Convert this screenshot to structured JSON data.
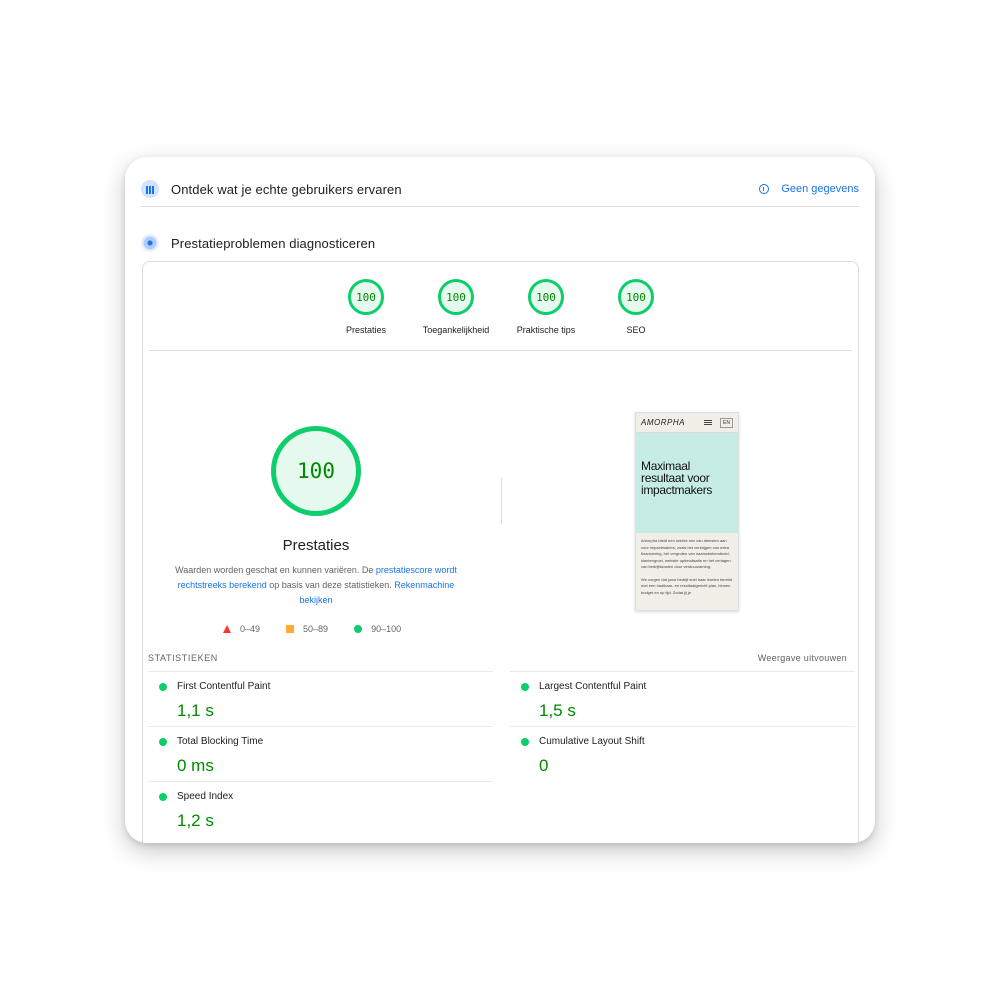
{
  "header": {
    "field_data_title": "Ontdek wat je echte gebruikers ervaren",
    "no_data_link": "Geen gegevens",
    "diagnose_title": "Prestatieproblemen diagnosticeren"
  },
  "categories": [
    {
      "score": "100",
      "label": "Prestaties"
    },
    {
      "score": "100",
      "label": "Toegankelijkheid"
    },
    {
      "score": "100",
      "label": "Praktische tips"
    },
    {
      "score": "100",
      "label": "SEO"
    }
  ],
  "performance": {
    "score": "100",
    "title": "Prestaties",
    "desc_part1": "Waarden worden geschat en kunnen variëren. De ",
    "desc_link1": "prestatiescore wordt rechtstreeks berekend",
    "desc_part2": " op basis van deze statistieken. ",
    "desc_link2": "Rekenmachine bekijken"
  },
  "legend": {
    "fail": "0–49",
    "average": "50–89",
    "pass": "90–100"
  },
  "screenshot": {
    "logo": "AMORPHA",
    "lang": "EN",
    "hero": "Maximaal resultaat voor impactmakers",
    "para1": "Amorpha biedt een unieke mix van diensten aan voor impactmakers, zoals het verkrijgen van extra financiering, het vergroten van naamsbekendheid, klantengroei, website optimalisatie en het verlagen van bedrijfskosten door verduurzaming.",
    "para2": "We zorgen dat jouw bedrijf snel haar doelen bereikt met een haalbaar- en resultaatgericht plan, binnen budget en op tijd. Zodat jij je"
  },
  "stats": {
    "title": "STATISTIEKEN",
    "expand": "Weergave uitvouwen",
    "metrics": [
      {
        "name": "First Contentful Paint",
        "value": "1,1 s"
      },
      {
        "name": "Largest Contentful Paint",
        "value": "1,5 s"
      },
      {
        "name": "Total Blocking Time",
        "value": "0 ms"
      },
      {
        "name": "Cumulative Layout Shift",
        "value": "0"
      },
      {
        "name": "Speed Index",
        "value": "1,2 s"
      }
    ]
  },
  "colors": {
    "pass": "#0cce6b",
    "pass_text": "#008800",
    "average": "#ffaa33",
    "fail": "#ff3333",
    "link": "#1a73e8"
  }
}
